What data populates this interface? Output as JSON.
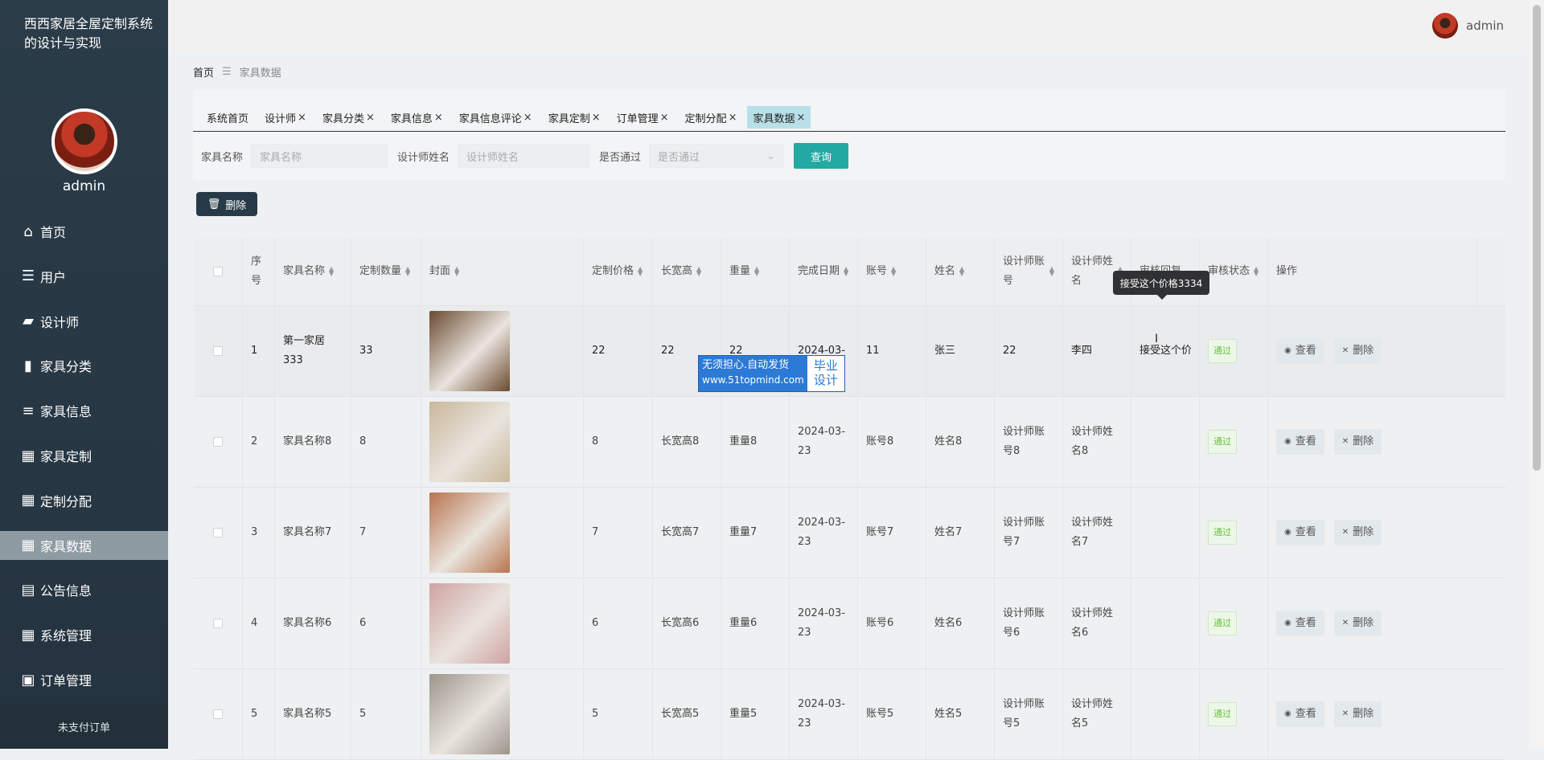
{
  "app_title": "西西家居全屋定制系统的设计与实现",
  "user": {
    "name": "admin"
  },
  "nav": [
    {
      "label": "首页",
      "icon": "home-icon"
    },
    {
      "label": "用户",
      "icon": "sliders-icon"
    },
    {
      "label": "设计师",
      "icon": "ticket-icon"
    },
    {
      "label": "家具分类",
      "icon": "bar-chart-icon"
    },
    {
      "label": "家具信息",
      "icon": "list-icon"
    },
    {
      "label": "家具定制",
      "icon": "grid-icon"
    },
    {
      "label": "定制分配",
      "icon": "grid-icon"
    },
    {
      "label": "家具数据",
      "icon": "grid-icon",
      "active": true
    },
    {
      "label": "公告信息",
      "icon": "book-icon"
    },
    {
      "label": "系统管理",
      "icon": "apps-icon"
    },
    {
      "label": "订单管理",
      "icon": "briefcase-icon"
    }
  ],
  "sidebar_footer": "未支付订单",
  "breadcrumb": {
    "home": "首页",
    "current": "家具数据"
  },
  "tabs": [
    {
      "label": "系统首页",
      "closable": false
    },
    {
      "label": "设计师",
      "closable": true
    },
    {
      "label": "家具分类",
      "closable": true
    },
    {
      "label": "家具信息",
      "closable": true
    },
    {
      "label": "家具信息评论",
      "closable": true
    },
    {
      "label": "家具定制",
      "closable": true
    },
    {
      "label": "订单管理",
      "closable": true
    },
    {
      "label": "定制分配",
      "closable": true
    },
    {
      "label": "家具数据",
      "closable": true,
      "active": true
    }
  ],
  "search": {
    "name_label": "家具名称",
    "name_placeholder": "家具名称",
    "designer_label": "设计师姓名",
    "designer_placeholder": "设计师姓名",
    "pass_label": "是否通过",
    "pass_placeholder": "是否通过",
    "button": "查询"
  },
  "delete_button": "删除",
  "table": {
    "headers": [
      "序号",
      "家具名称",
      "定制数量",
      "封面",
      "定制价格",
      "长宽高",
      "重量",
      "完成日期",
      "账号",
      "姓名",
      "设计师账号",
      "设计师姓名",
      "审核回复",
      "审核状态",
      "操作"
    ],
    "rows": [
      {
        "no": "1",
        "name": "第一家居333",
        "qty": "33",
        "price": "22",
        "dim": "22",
        "weight": "22",
        "date": "2024-03-",
        "account": "11",
        "person": "张三",
        "d_account": "22",
        "d_name": "李四",
        "reply": "接受这个价格",
        "status": "通过",
        "cover_color": "#6b4a30"
      },
      {
        "no": "2",
        "name": "家具名称8",
        "qty": "8",
        "price": "8",
        "dim": "长宽高8",
        "weight": "重量8",
        "date": "2024-03-23",
        "account": "账号8",
        "person": "姓名8",
        "d_account": "设计师账号8",
        "d_name": "设计师姓名8",
        "reply": "",
        "status": "通过",
        "cover_color": "#c9b79a"
      },
      {
        "no": "3",
        "name": "家具名称7",
        "qty": "7",
        "price": "7",
        "dim": "长宽高7",
        "weight": "重量7",
        "date": "2024-03-23",
        "account": "账号7",
        "person": "姓名7",
        "d_account": "设计师账号7",
        "d_name": "设计师姓名7",
        "reply": "",
        "status": "通过",
        "cover_color": "#b8744e"
      },
      {
        "no": "4",
        "name": "家具名称6",
        "qty": "6",
        "price": "6",
        "dim": "长宽高6",
        "weight": "重量6",
        "date": "2024-03-23",
        "account": "账号6",
        "person": "姓名6",
        "d_account": "设计师账号6",
        "d_name": "设计师姓名6",
        "reply": "",
        "status": "通过",
        "cover_color": "#cfa3a3"
      },
      {
        "no": "5",
        "name": "家具名称5",
        "qty": "5",
        "price": "5",
        "dim": "长宽高5",
        "weight": "重量5",
        "date": "2024-03-23",
        "account": "账号5",
        "person": "姓名5",
        "d_account": "设计师账号5",
        "d_name": "设计师姓名5",
        "reply": "",
        "status": "通过",
        "cover_color": "#9c958c"
      }
    ],
    "view_label": "查看",
    "delete_label": "删除"
  },
  "tooltip": "接受这个价格3334",
  "watermark": {
    "line1": "无须担心.自动发货",
    "line2": "www.51topmind.com",
    "right1": "毕业",
    "right2": "设计"
  }
}
